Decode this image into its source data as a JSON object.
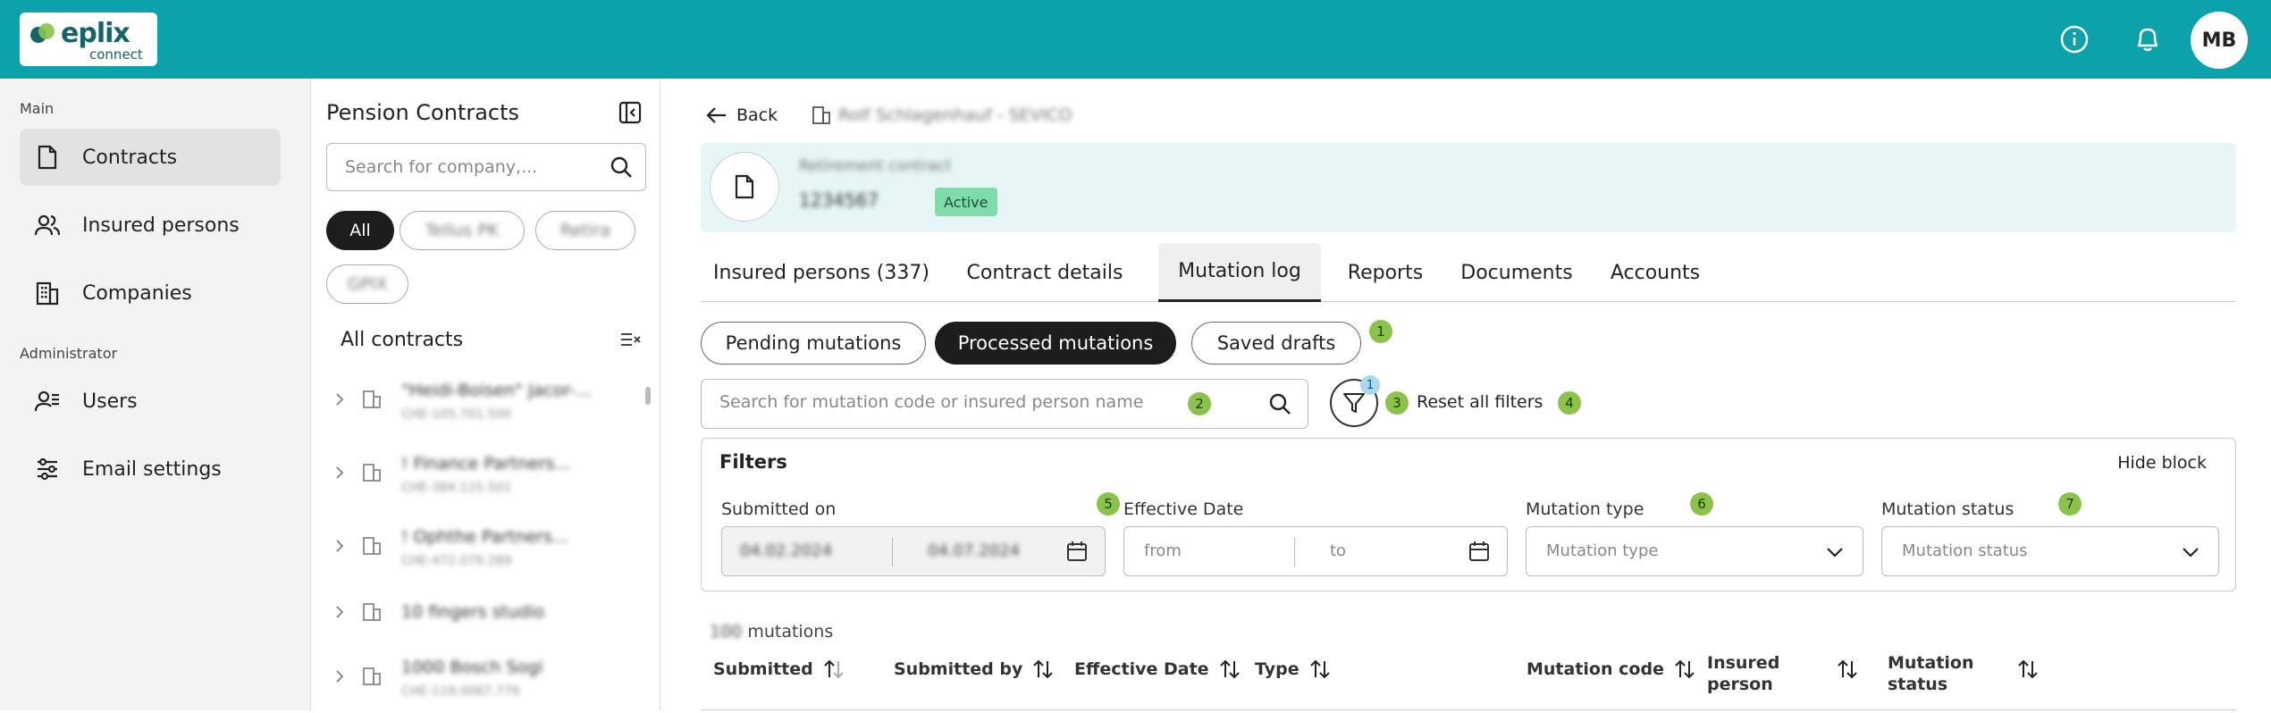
{
  "brand": {
    "name": "eplix",
    "sub": "connect"
  },
  "topbar": {
    "avatar_initials": "MB",
    "info_icon": "info-icon",
    "bell_icon": "bell-icon"
  },
  "sidebar": {
    "section_main": "Main",
    "section_admin": "Administrator",
    "items": [
      {
        "label": "Contracts",
        "icon": "document-icon",
        "active": true
      },
      {
        "label": "Insured persons",
        "icon": "users-icon"
      },
      {
        "label": "Companies",
        "icon": "building-icon"
      },
      {
        "label": "Users",
        "icon": "user-admin-icon"
      },
      {
        "label": "Email settings",
        "icon": "sliders-icon"
      }
    ]
  },
  "contracts_panel": {
    "title": "Pension Contracts",
    "search_placeholder": "Search for company,...",
    "chips": [
      "All",
      "Tellus PK",
      "Retira",
      "GPIX"
    ],
    "list_title": "All contracts",
    "rows": [
      {
        "name": "\"Heidi-Boisen\" Jacor-...",
        "number": "CHE-105.701.500"
      },
      {
        "name": "! Finance Partners...",
        "number": "CHE-384.115.501"
      },
      {
        "name": "! Ophthe Partners...",
        "number": "CHE-472.079.289"
      },
      {
        "name": "10 fingers studio",
        "number": ""
      },
      {
        "name": "1000 Bosch Sogi",
        "number": "CHE-119.0087.779"
      }
    ]
  },
  "main": {
    "back_label": "Back",
    "breadcrumb": "Rolf Schlagenhauf - SEVICO",
    "card": {
      "type": "Retirement contract",
      "number": "1234567",
      "status": "Active"
    },
    "tabs": [
      {
        "label": "Insured persons (337)"
      },
      {
        "label": "Contract details"
      },
      {
        "label": "Mutation log",
        "active": true
      },
      {
        "label": "Reports"
      },
      {
        "label": "Documents"
      },
      {
        "label": "Accounts"
      }
    ],
    "pills": [
      "Pending mutations",
      "Processed mutations",
      "Saved drafts"
    ],
    "search_placeholder": "Search for mutation code or insured person name",
    "filter_count": "1",
    "reset_label": "Reset all filters",
    "steps": [
      "1",
      "2",
      "3",
      "4",
      "5",
      "6",
      "7"
    ],
    "filters": {
      "title": "Filters",
      "hide_label": "Hide block",
      "submitted_on": {
        "label": "Submitted on",
        "from": "04.02.2024",
        "to": "04.07.2024"
      },
      "effective_date": {
        "label": "Effective Date",
        "from": "from",
        "to": "to"
      },
      "mutation_type": {
        "label": "Mutation type",
        "placeholder": "Mutation type"
      },
      "mutation_status": {
        "label": "Mutation status",
        "placeholder": "Mutation status"
      }
    },
    "mutations_count": "100",
    "mutations_label": "mutations",
    "table_headers": [
      "Submitted",
      "Submitted by",
      "Effective Date",
      "Type",
      "Mutation code",
      "Insured person",
      "Mutation status"
    ]
  }
}
